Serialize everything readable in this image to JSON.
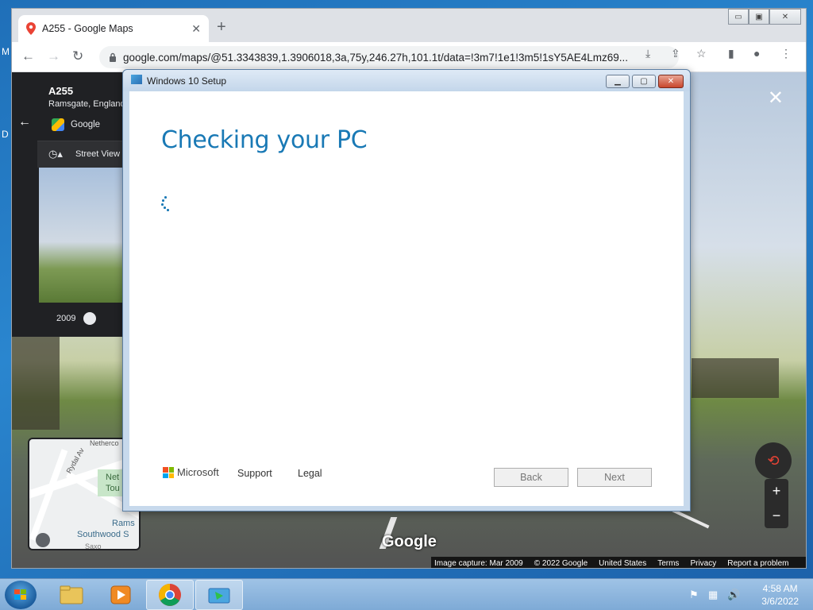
{
  "desktop": {
    "letter_m": "M",
    "letter_d": "D"
  },
  "browser": {
    "tab_title": "A255 - Google Maps",
    "tab_close": "✕",
    "new_tab": "+",
    "url": "google.com/maps/@51.3343839,1.3906018,3a,75y,246.27h,101.1t/data=!3m7!1e1!3m5!1sY5AE4Lmz69...",
    "window_controls": {
      "minimize": "▭",
      "restore": "▣",
      "close": "✕"
    }
  },
  "maps": {
    "place_title": "A255",
    "place_subtitle": "Ramsgate, England",
    "provider": "Google",
    "street_view_label": "Street View -",
    "year": "2009",
    "minimap_labels": {
      "netherco": "Netherco",
      "rydal": "Rydal Av",
      "net": "Net",
      "tou": "Tou",
      "rams": "Rams",
      "southwood": "Southwood S",
      "saxe": "Saxo"
    },
    "google_mark": "Google",
    "footer": {
      "capture": "Image capture: Mar 2009",
      "copyright": "© 2022 Google",
      "country": "United States",
      "terms": "Terms",
      "privacy": "Privacy",
      "report": "Report a problem"
    },
    "zoom_in": "+",
    "zoom_out": "−",
    "close": "✕"
  },
  "setup": {
    "window_title": "Windows 10 Setup",
    "heading": "Checking your PC",
    "brand": "Microsoft",
    "support": "Support",
    "legal": "Legal",
    "back": "Back",
    "next": "Next",
    "controls": {
      "minimize": "▁",
      "restore": "▢",
      "close": "✕"
    }
  },
  "taskbar": {
    "time": "4:58 AM",
    "date": "3/6/2022"
  },
  "colors": {
    "setup_heading": "#1979b5",
    "ms_red": "#f25022",
    "ms_green": "#7fba00",
    "ms_blue": "#00a4ef",
    "ms_yellow": "#ffb900"
  }
}
